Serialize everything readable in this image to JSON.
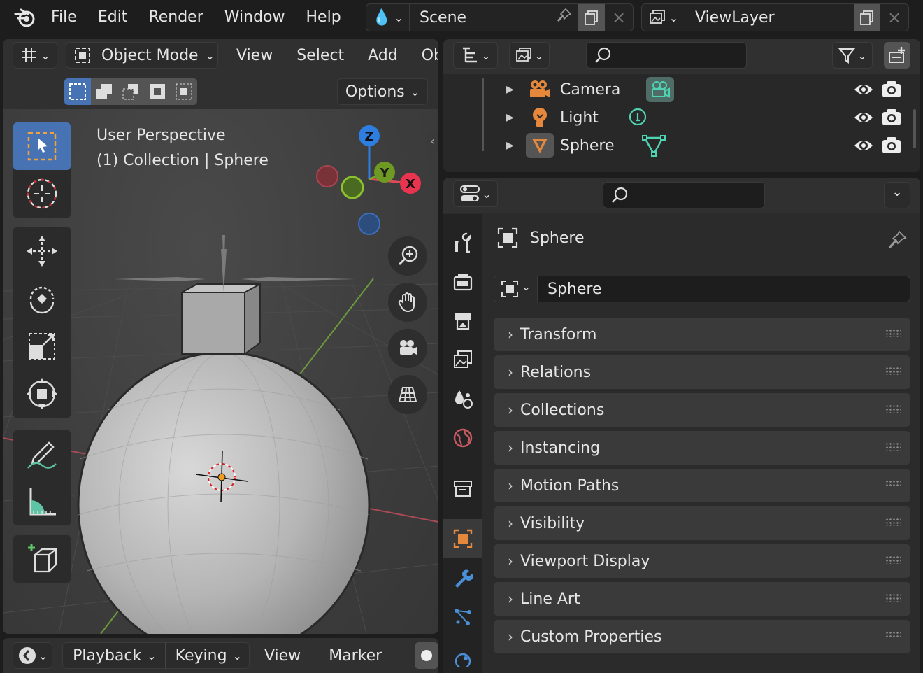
{
  "topbar": {
    "menus": [
      "File",
      "Edit",
      "Render",
      "Window",
      "Help"
    ],
    "scene": "Scene",
    "view_layer": "ViewLayer"
  },
  "viewport": {
    "mode": "Object Mode",
    "menus": [
      "View",
      "Select",
      "Add",
      "Obje"
    ],
    "options_label": "Options",
    "overlay_line1": "User Perspective",
    "overlay_line2": "(1) Collection | Sphere",
    "gizmo": {
      "z": "Z",
      "y": "Y",
      "x": "X"
    },
    "tools": [
      "select-box",
      "cursor",
      "move",
      "rotate",
      "scale",
      "transform",
      "annotate",
      "measure",
      "add-cube"
    ]
  },
  "timeline": {
    "menus": [
      "Playback",
      "Keying",
      "View",
      "Marker"
    ]
  },
  "outliner": {
    "search_placeholder": "",
    "items": [
      {
        "name": "Camera",
        "icon": "camera-icon",
        "data_icon": "camera-data-icon"
      },
      {
        "name": "Light",
        "icon": "light-icon",
        "data_icon": "light-data-icon"
      },
      {
        "name": "Sphere",
        "icon": "mesh-object-icon",
        "data_icon": "mesh-data-icon"
      }
    ]
  },
  "properties": {
    "search_placeholder": "",
    "context_name": "Sphere",
    "object_name": "Sphere",
    "panels": [
      "Transform",
      "Relations",
      "Collections",
      "Instancing",
      "Motion Paths",
      "Visibility",
      "Viewport Display",
      "Line Art",
      "Custom Properties"
    ],
    "colors": {
      "accent": "#4772b3",
      "object": "#e5883c",
      "active_tab_bg": "#3a3a3a"
    }
  }
}
